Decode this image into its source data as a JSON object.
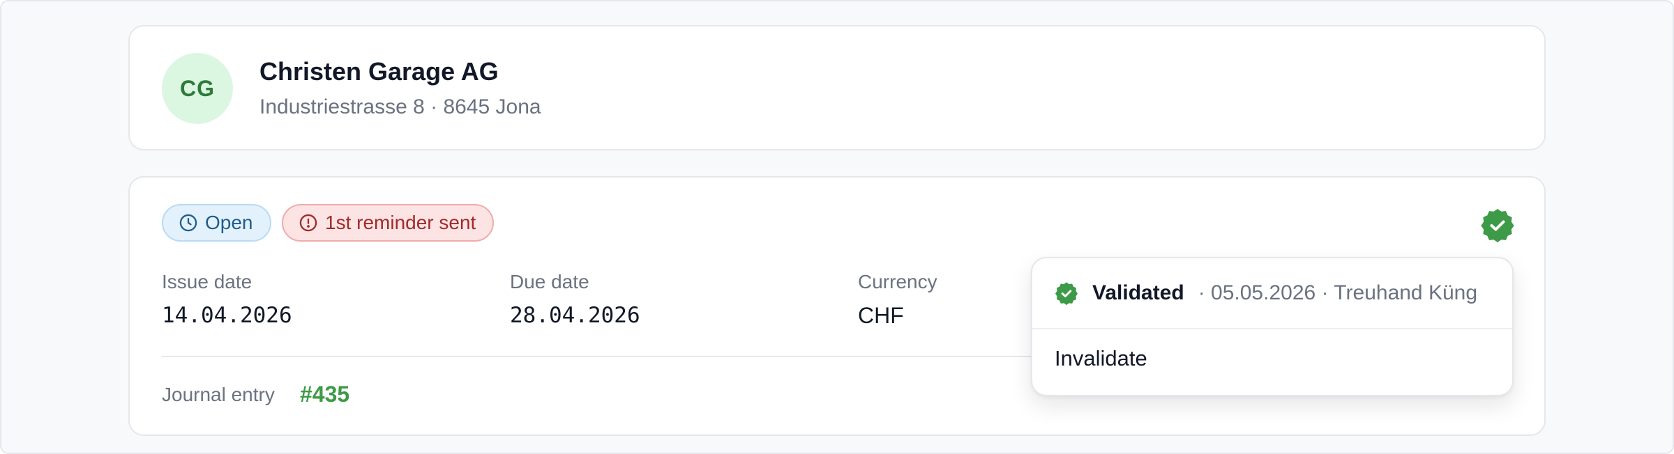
{
  "company": {
    "initials": "CG",
    "name": "Christen Garage AG",
    "address": "Industriestrasse 8 · 8645 Jona"
  },
  "invoice": {
    "badges": {
      "open": "Open",
      "reminder": "1st reminder sent"
    },
    "fields": {
      "issue_label": "Issue date",
      "issue_value": "14.04.2026",
      "due_label": "Due date",
      "due_value": "28.04.2026",
      "currency_label": "Currency",
      "currency_value": "CHF"
    },
    "journal": {
      "label": "Journal entry",
      "number": "#435"
    }
  },
  "validation_menu": {
    "status": "Validated",
    "meta": "· 05.05.2026 · Treuhand Küng",
    "action": "Invalidate"
  },
  "icons": {
    "open": "clock-icon",
    "reminder": "alert-circle-icon",
    "validated": "verified-badge-icon"
  },
  "colors": {
    "accent_green": "#3d9a47",
    "open_blue": "#1f5e8c",
    "reminder_red": "#a02b2b",
    "avatar_bg": "#dcf7e1"
  }
}
